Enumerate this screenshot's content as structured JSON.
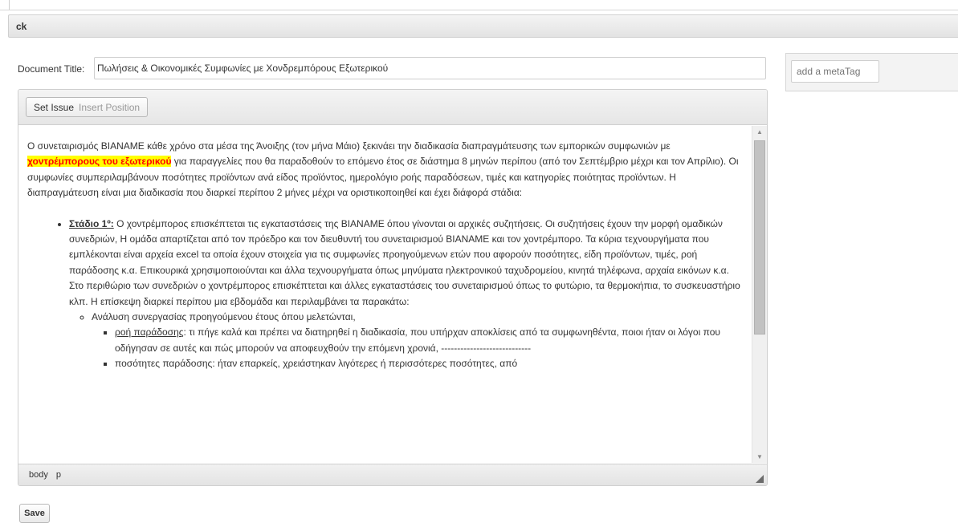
{
  "panel": {
    "title": "ck"
  },
  "document": {
    "title_label": "Document Title:",
    "title_value": "Πωλήσεις & Οικονομικές Συμφωνίες με Χονδρεμπόρους Εξωτερικού"
  },
  "toolbar": {
    "set_issue": "Set Issue",
    "insert_position": "Insert Position"
  },
  "content": {
    "intro_before": "Ο συνεταιρισμός ΒΙΑΝΑΜΕ κάθε χρόνο στα μέσα της Άνοιξης (τον μήνα Μάιο) ξεκινάει την διαδικασία διαπραγμάτευσης των εμπορικών συμφωνιών με ",
    "intro_highlight": "χοντρέμπορους του εξωτερικού",
    "intro_after": " για παραγγελίες που θα παραδοθούν το επόμενο έτος σε διάστημα 8 μηνών περίπου (από τον Σεπτέμβριο μέχρι και τον Απρίλιο). Οι συμφωνίες συμπεριλαμβάνουν ποσότητες προϊόντων ανά είδος προϊόντος, ημερολόγιο ροής παραδόσεων, τιμές και κατηγορίες ποιότητας προϊόντων. Η διαπραγμάτευση είναι μια διαδικασία που διαρκεί περίπου 2 μήνες μέχρι να οριστικοποιηθεί και έχει διάφορά στάδια:",
    "stage1_label": "Στάδιο 1º:",
    "stage1_text": " Ο χοντρέμπορος επισκέπτεται τις εγκαταστάσεις της ΒΙΑΝΑΜΕ όπου γίνονται οι αρχικές  συζητήσεις. Οι συζητήσεις έχουν την μορφή ομαδικών συνεδριών, Η ομάδα απαρτίζεται από τον πρόεδρο και τον διευθυντή του συνεταιρισμού ΒΙΑΝΑΜΕ και τον χοντρέμπορο. Τα κύρια τεχνουργήματα που εμπλέκονται είναι αρχεία excel τα οποία έχουν στοιχεία για τις συμφωνίες προηγούμενων ετών που αφορούν ποσότητες, είδη προϊόντων, τιμές, ροή παράδοσης κ.α. Επικουρικά χρησιμοποιούνται και άλλα τεχνουργήματα όπως μηνύματα ηλεκτρονικού ταχυδρομείου, κινητά τηλέφωνα, αρχαία εικόνων κ.α. Στο περιθώριο των συνεδριών ο χοντρέμπορος επισκέπτεται και άλλες εγκαταστάσεις του συνεταιρισμού όπως το φυτώριο, τα θερμοκήπια, το συσκευαστήριο κλπ. Η επίσκεψη διαρκεί περίπου μια εβδομάδα και περιλαμβάνει τα παρακάτω:",
    "sub1": "Ανάλυση συνεργασίας προηγούμενου έτους όπου μελετώνται,",
    "item1_label": "ροή παράδοσης",
    "item1_text": ": τι πήγε καλά και πρέπει να διατηρηθεί η διαδικασία, που υπήρχαν αποκλίσεις από τα συμφωνηθέντα, ποιοι ήταν οι λόγοι που οδήγησαν σε αυτές και πώς μπορούν να αποφευχθούν την επόμενη χρονιά,   ----------------------------",
    "item2_text": "ποσότητες παράδοσης: ήταν επαρκείς, χρειάστηκαν λιγότερες ή περισσότερες ποσότητες, από"
  },
  "statusbar": {
    "path": [
      "body",
      "p"
    ]
  },
  "actions": {
    "save": "Save"
  },
  "meta": {
    "placeholder": "add a metaTag"
  }
}
